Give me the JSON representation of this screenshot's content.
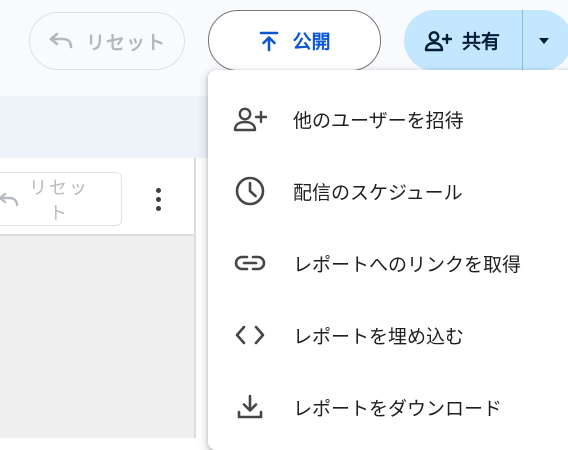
{
  "header": {
    "reset_label": "リセット",
    "publish_label": "公開",
    "share_label": "共有"
  },
  "toolbar": {
    "reset_label": "リセット"
  },
  "share_menu": {
    "items": [
      {
        "label": "他のユーザーを招待",
        "icon": "person-add-icon"
      },
      {
        "label": "配信のスケジュール",
        "icon": "clock-icon"
      },
      {
        "label": "レポートへのリンクを取得",
        "icon": "link-icon"
      },
      {
        "label": "レポートを埋め込む",
        "icon": "code-icon"
      },
      {
        "label": "レポートをダウンロード",
        "icon": "download-icon"
      }
    ]
  },
  "colors": {
    "accent": "#0b57d0",
    "share_bg": "#c2e7ff",
    "disabled": "#b4b8bd"
  }
}
